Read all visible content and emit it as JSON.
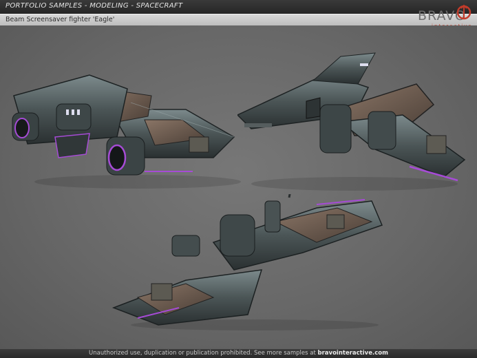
{
  "header": {
    "title": "PORTFOLIO SAMPLES - MODELING - SPACECRAFT"
  },
  "subheader": {
    "title": "Beam Screensaver fighter 'Eagle'"
  },
  "logo": {
    "word": "BRAVO",
    "sub": "interactive",
    "icon": "bravo-logo-mark"
  },
  "footer": {
    "text": "Unauthorized use, duplication or publication prohibited. See more samples at",
    "link": "bravointeractive.com"
  },
  "colors": {
    "header": "#2e2e2e",
    "subheader": "#cfcfcf",
    "background": "#6b6b6b",
    "accent": "#c23b2a",
    "glow": "#a64bd6"
  }
}
